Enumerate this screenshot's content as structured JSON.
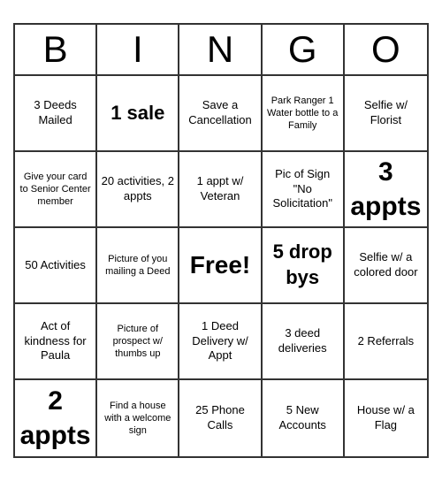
{
  "header": {
    "letters": [
      "B",
      "I",
      "N",
      "G",
      "O"
    ]
  },
  "cells": [
    {
      "text": "3 Deeds Mailed",
      "size": "normal"
    },
    {
      "text": "1 sale",
      "size": "large"
    },
    {
      "text": "Save a Cancellation",
      "size": "normal"
    },
    {
      "text": "Park Ranger 1 Water bottle to a Family",
      "size": "small"
    },
    {
      "text": "Selfie w/ Florist",
      "size": "normal"
    },
    {
      "text": "Give your card to Senior Center member",
      "size": "small"
    },
    {
      "text": "20 activities, 2 appts",
      "size": "normal"
    },
    {
      "text": "1 appt w/ Veteran",
      "size": "normal"
    },
    {
      "text": "Pic of Sign \"No Solicitation\"",
      "size": "normal"
    },
    {
      "text": "3 appts",
      "size": "xl"
    },
    {
      "text": "50 Activities",
      "size": "normal"
    },
    {
      "text": "Picture of you mailing a Deed",
      "size": "small"
    },
    {
      "text": "Free!",
      "size": "free"
    },
    {
      "text": "5 drop bys",
      "size": "large"
    },
    {
      "text": "Selfie w/ a colored door",
      "size": "normal"
    },
    {
      "text": "Act of kindness for Paula",
      "size": "normal"
    },
    {
      "text": "Picture of prospect w/ thumbs up",
      "size": "small"
    },
    {
      "text": "1 Deed Delivery w/ Appt",
      "size": "normal"
    },
    {
      "text": "3 deed deliveries",
      "size": "normal"
    },
    {
      "text": "2 Referrals",
      "size": "normal"
    },
    {
      "text": "2 appts",
      "size": "xl"
    },
    {
      "text": "Find a house with a welcome sign",
      "size": "small"
    },
    {
      "text": "25 Phone Calls",
      "size": "normal"
    },
    {
      "text": "5 New Accounts",
      "size": "normal"
    },
    {
      "text": "House w/ a Flag",
      "size": "normal"
    }
  ]
}
